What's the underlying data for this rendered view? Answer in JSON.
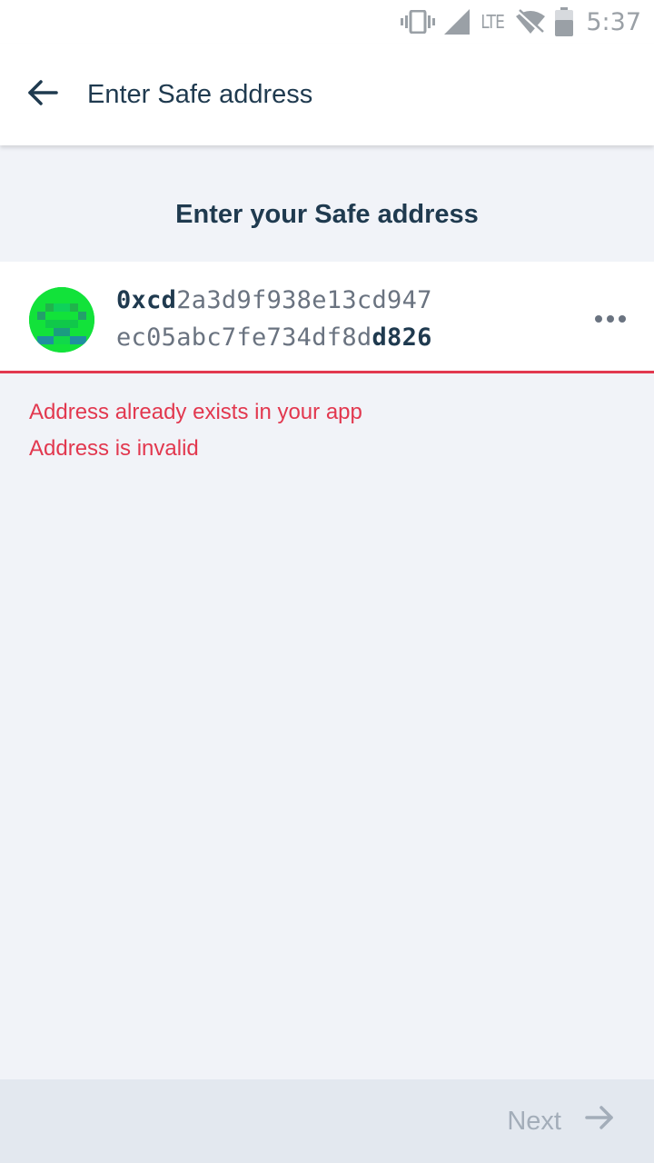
{
  "status_bar": {
    "network": "LTE",
    "time": "5:37",
    "icons": [
      "vibrate-icon",
      "signal-icon",
      "wifi-off-icon",
      "battery-icon"
    ]
  },
  "app_bar": {
    "title": "Enter Safe address",
    "back_icon": "arrow-left-icon"
  },
  "heading": "Enter your Safe address",
  "address": {
    "line1_prefix": "0xcd",
    "line1_rest": "2a3d9f938e13cd947",
    "line2_start": "ec05abc7fe734df8d",
    "line2_suffix": "d826",
    "more_icon": "more-horizontal-icon"
  },
  "errors": [
    "Address already exists in your app",
    "Address is invalid"
  ],
  "footer": {
    "next_label": "Next",
    "next_icon": "arrow-right-icon"
  },
  "colors": {
    "error": "#e2384f",
    "primary_text": "#1f3a4f",
    "disabled": "#a3adb9"
  }
}
